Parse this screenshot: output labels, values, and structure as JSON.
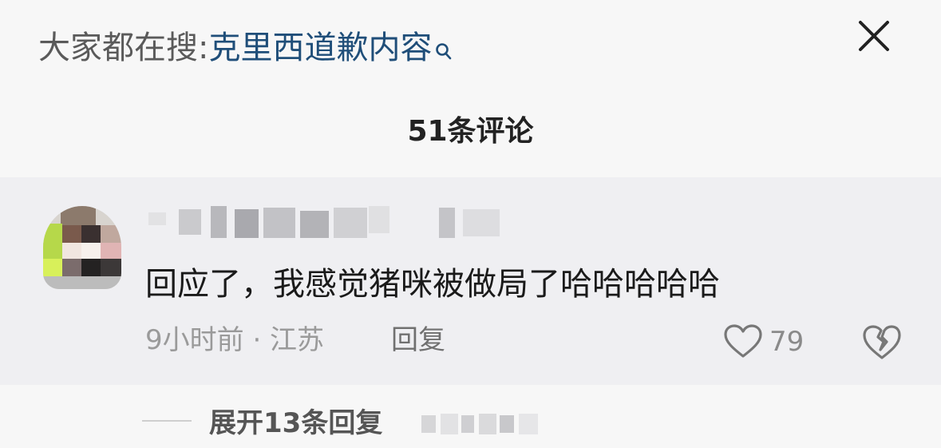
{
  "header": {
    "search_prefix": "大家都在搜:",
    "search_term": "克里西道歉内容",
    "search_icon": "search-icon",
    "close_icon": "close-icon",
    "comment_count": "51条评论"
  },
  "comment": {
    "avatar": "avatar-pixelated",
    "text": "回应了，我感觉猪咪被做局了哈哈哈哈哈",
    "meta": "9小时前 · 江苏",
    "reply_label": "回复",
    "like_icon": "heart-icon",
    "like_count": "79",
    "dislike_icon": "broken-heart-icon"
  },
  "replies": {
    "expand_label": "展开13条回复"
  },
  "colors": {
    "search_term": "#1f4e79",
    "background": "#f7f7f7",
    "comment_bg": "#efeff2",
    "muted_text": "#9a9a9a"
  }
}
